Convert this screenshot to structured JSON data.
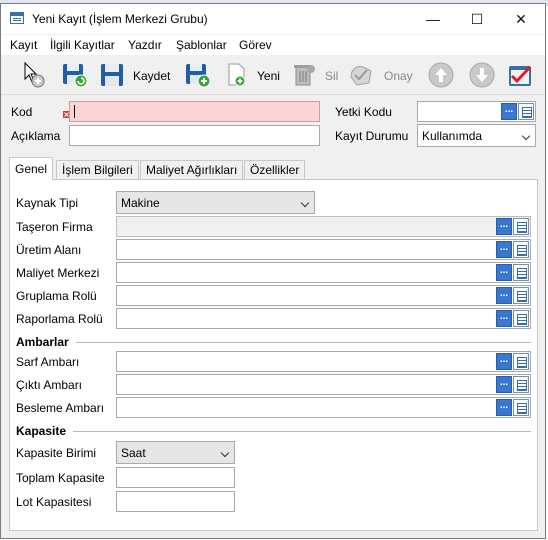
{
  "window": {
    "title": "Yeni Kayıt (İşlem Merkezi Grubu)",
    "minimize_glyph": "—",
    "maximize_glyph": "☐",
    "close_glyph": "✕"
  },
  "menu": [
    "Kayıt",
    "İlgili Kayıtlar",
    "Yazdır",
    "Şablonlar",
    "Görev"
  ],
  "toolbar": {
    "save_label": "Kaydet",
    "new_label": "Yeni",
    "delete_label": "Sil",
    "approve_label": "Onay"
  },
  "header_form": {
    "kod_label": "Kod",
    "kod_value": "",
    "aciklama_label": "Açıklama",
    "aciklama_value": "",
    "yetki_kodu_label": "Yetki Kodu",
    "yetki_kodu_value": "",
    "kayit_durumu_label": "Kayıt Durumu",
    "kayit_durumu_value": "Kullanımda",
    "lookup_dots": "..."
  },
  "tabs": [
    "Genel",
    "İşlem Bilgileri",
    "Maliyet Ağırlıkları",
    "Özellikler"
  ],
  "general": {
    "kaynak_tipi_label": "Kaynak Tipi",
    "kaynak_tipi_value": "Makine",
    "taseron_firma_label": "Taşeron Firma",
    "uretim_alani_label": "Üretim Alanı",
    "maliyet_merkezi_label": "Maliyet Merkezi",
    "gruplama_rolu_label": "Gruplama Rolü",
    "raporlama_rolu_label": "Raporlama Rolü",
    "ambarlar_title": "Ambarlar",
    "sarf_ambari_label": "Sarf Ambarı",
    "cikti_ambari_label": "Çıktı Ambarı",
    "besleme_ambari_label": "Besleme Ambarı",
    "kapasite_title": "Kapasite",
    "kapasite_birimi_label": "Kapasite Birimi",
    "kapasite_birimi_value": "Saat",
    "toplam_kapasite_label": "Toplam Kapasite",
    "lot_kapasitesi_label": "Lot Kapasitesi"
  },
  "colors": {
    "required_field": "#fcd4d4",
    "lookup_button": "#3a78d0",
    "window_bg": "#f0f0f0"
  }
}
